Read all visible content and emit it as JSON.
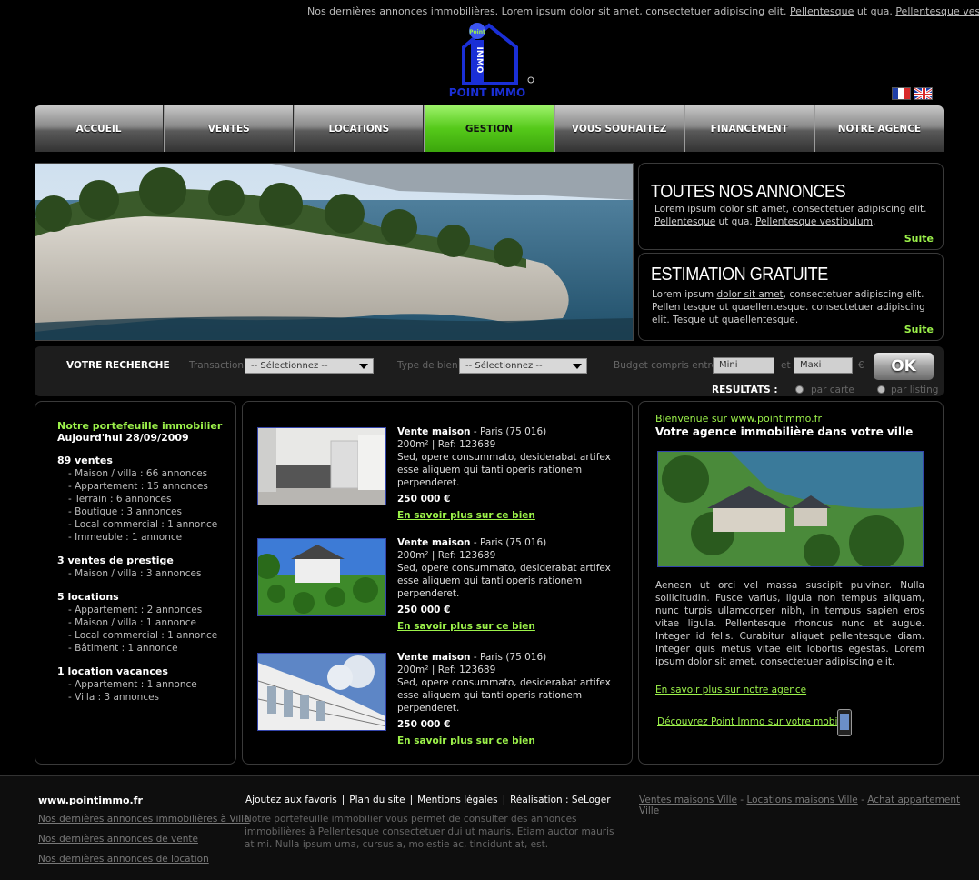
{
  "top": {
    "text": "Nos dernières annonces  immobilières. Lorem ipsum dolor sit amet, consectetuer adipiscing elit.",
    "link1": "Pellentesque",
    "mid": " ut qua. ",
    "link2": "Pellentesque vestibulum",
    "tail": "."
  },
  "logo": {
    "text": "POINT IMMO",
    "emblem": "IMMO",
    "badge": "Point"
  },
  "languages": [
    {
      "name": "french-flag-icon"
    },
    {
      "name": "uk-flag-icon"
    }
  ],
  "nav": [
    "ACCUEIL",
    "VENTES",
    "LOCATIONS",
    "GESTION",
    "VOUS SOUHAITEZ",
    "FINANCEMENT",
    "NOTRE AGENCE"
  ],
  "nav_active_index": 3,
  "promo1": {
    "title": "TOUTES NOS ANNONCES",
    "text1": "Lorem ipsum dolor sit amet, consectetuer adipiscing elit.",
    "link1": "Pellentesque",
    "mid": " ut qua. ",
    "link2": "Pellentesque vestibulum",
    "tail": ".",
    "suite": "Suite"
  },
  "promo2": {
    "title": "ESTIMATION GRATUITE",
    "pre": "Lorem ipsum ",
    "link": "dolor sit amet",
    "text": ", consectetuer adipiscing elit. Pellen tesque ut quaellentesque. consectetuer adipiscing elit. Tesque ut quaellentesque.",
    "suite": "Suite"
  },
  "search": {
    "title": "VOTRE RECHERCHE",
    "transaction_label": "Transaction",
    "transaction_value": "-- Sélectionnez --",
    "type_label": "Type de bien",
    "type_value": "-- Sélectionnez --",
    "budget_label": "Budget compris entre",
    "mini": "Mini",
    "et": "et",
    "maxi": "Maxi",
    "currency": "€",
    "ok": "OK",
    "results_label": "RESULTATS :",
    "opt_carte": "par carte",
    "opt_listing": "par listing"
  },
  "portfolio": {
    "title": "Notre portefeuille immobilier",
    "date": "Aujourd'hui 28/09/2009",
    "groups": [
      {
        "head": "89  ventes",
        "items": [
          "- Maison / villa : 66 annonces",
          "- Appartement : 15 annonces",
          "- Terrain : 6 annonces",
          "- Boutique : 3 annonces",
          "- Local commercial : 1 annonce",
          "- Immeuble : 1 annonce"
        ]
      },
      {
        "head": "3 ventes de prestige",
        "items": [
          "- Maison / villa : 3 annonces"
        ]
      },
      {
        "head": "5  locations",
        "items": [
          "- Appartement : 2 annonces",
          "- Maison / villa : 1 annonce",
          "- Local commercial : 1 annonce",
          "- Bâtiment : 1 annonce"
        ]
      },
      {
        "head": "1 location vacances",
        "items": [
          "- Appartement : 1 annonce",
          "- Villa : 3 annonces"
        ]
      }
    ]
  },
  "listings": [
    {
      "title": "Vente maison",
      "loc": " - Paris (75 016)",
      "ref": "200m² | Ref: 123689",
      "desc": "Sed, opere consummato, desiderabat artifex esse aliquem qui tanti operis rationem perpenderet.",
      "price": "250 000 €",
      "more": "En savoir plus sur ce bien"
    },
    {
      "title": "Vente maison",
      "loc": " - Paris (75 016)",
      "ref": "200m² | Ref: 123689",
      "desc": "Sed, opere consummato, desiderabat artifex esse aliquem qui tanti operis rationem perpenderet.",
      "price": "250 000 €",
      "more": "En savoir plus sur ce bien"
    },
    {
      "title": "Vente maison",
      "loc": " - Paris (75 016)",
      "ref": "200m² | Ref: 123689",
      "desc": "Sed, opere consummato, desiderabat artifex esse aliquem qui tanti operis rationem perpenderet.",
      "price": "250 000 €",
      "more": "En savoir plus sur ce bien"
    }
  ],
  "agency": {
    "welcome": "Bienvenue sur www.pointimmo.fr",
    "subtitle": "Votre agence immobilière dans votre ville",
    "text": "Aenean ut orci vel massa suscipit pulvinar. Nulla sollicitudin. Fusce varius, ligula non tempus aliquam, nunc turpis ullamcorper nibh, in tempus sapien eros vitae ligula. Pellentesque rhoncus nunc et augue. Integer id felis. Curabitur aliquet pellentesque diam. Integer quis metus vitae elit lobortis egestas. Lorem ipsum dolor sit amet, consectetuer adipiscing elit.",
    "link1": "En savoir plus sur notre agence",
    "link2": "Découvrez Point Immo sur votre mobile"
  },
  "footer": {
    "site": "www.pointimmo.fr",
    "left_links": [
      "Nos dernières annonces immobilières à Ville",
      "Nos dernières annonces de vente",
      "Nos dernières annonces de location"
    ],
    "links": [
      "Ajoutez aux favoris",
      "Plan du site",
      "Mentions légales",
      "Réalisation : SeLoger"
    ],
    "desc": "Notre portefeuille immobilier vous permet de consulter des annonces immobilières à Pellentesque consectetuer dui ut mauris. Etiam auctor mauris at mi. Nulla ipsum urna, cursus a, molestie ac, tincidunt at, est.",
    "right_links": [
      "Ventes maisons Ville",
      "Locations maisons Ville",
      "Achat appartement Ville"
    ],
    "right_sep": " - "
  },
  "colors": {
    "accent": "#9cf24a",
    "nav_active": "#55c91a",
    "logo_blue": "#1a2fd6"
  }
}
